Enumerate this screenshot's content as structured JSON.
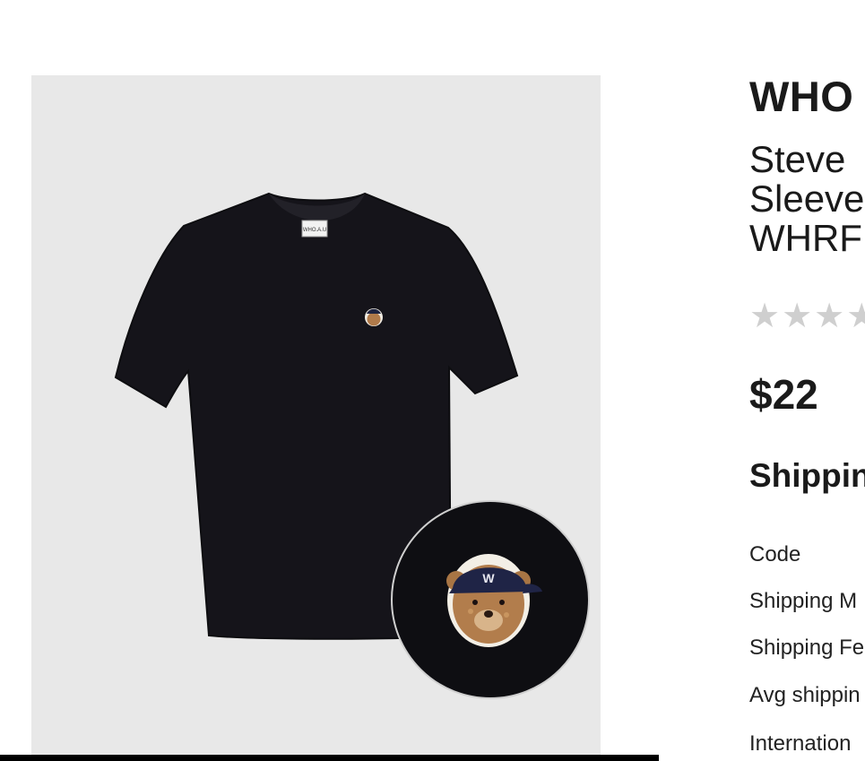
{
  "product": {
    "brand": "WHO",
    "title": "Steve\nSleeve\nWHRF",
    "rating": {
      "max_stars": 5,
      "filled_stars": 0
    },
    "price": "$22",
    "image": {
      "subject": "tshirt-image",
      "inset": "bear-patch-closeup",
      "label_text": "WHO.A.U"
    }
  },
  "shipping": {
    "heading": "Shippin",
    "rows": [
      {
        "label": "Code"
      },
      {
        "label": "Shipping M"
      },
      {
        "label": "Shipping Fe"
      },
      {
        "label": "Avg shippin"
      },
      {
        "label": "Internation"
      }
    ]
  },
  "colors": {
    "image_bg": "#e8e8e8",
    "shirt": "#15141a",
    "star_empty": "#cfcfcf",
    "text": "#1a1a1a"
  }
}
